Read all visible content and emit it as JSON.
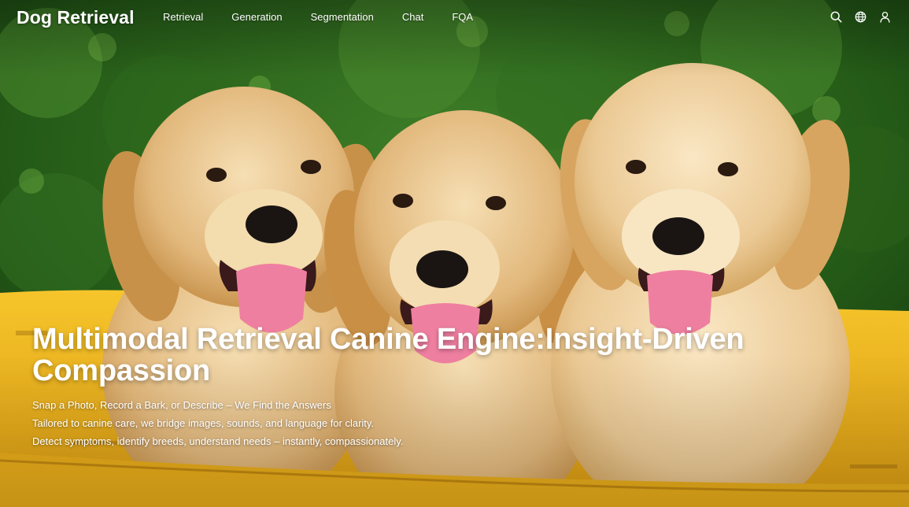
{
  "header": {
    "brand": "Dog Retrieval",
    "nav": [
      {
        "label": "Retrieval"
      },
      {
        "label": "Generation"
      },
      {
        "label": "Segmentation"
      },
      {
        "label": "Chat"
      },
      {
        "label": "FQA"
      }
    ],
    "tools": [
      {
        "icon": "search-icon"
      },
      {
        "icon": "globe-icon"
      },
      {
        "icon": "user-icon"
      }
    ]
  },
  "hero": {
    "title": "Multimodal Retrieval Canine Engine:Insight-Driven Compassion",
    "lines": [
      "Snap a Photo, Record a Bark, or Describe – We Find the Answers",
      "Tailored to canine care, we bridge images, sounds, and language for clarity.",
      "Detect symptoms, identify breeds, understand needs – instantly, compassionately."
    ],
    "background": {
      "subject": "three golden retriever puppies in a yellow wheelbarrow",
      "colors": {
        "foliage": "#2f6b1f",
        "wheelbarrow": "#f2b61c",
        "fur": "#e9c58d",
        "tongue": "#ef7fa0",
        "nose": "#1a1512"
      }
    }
  }
}
